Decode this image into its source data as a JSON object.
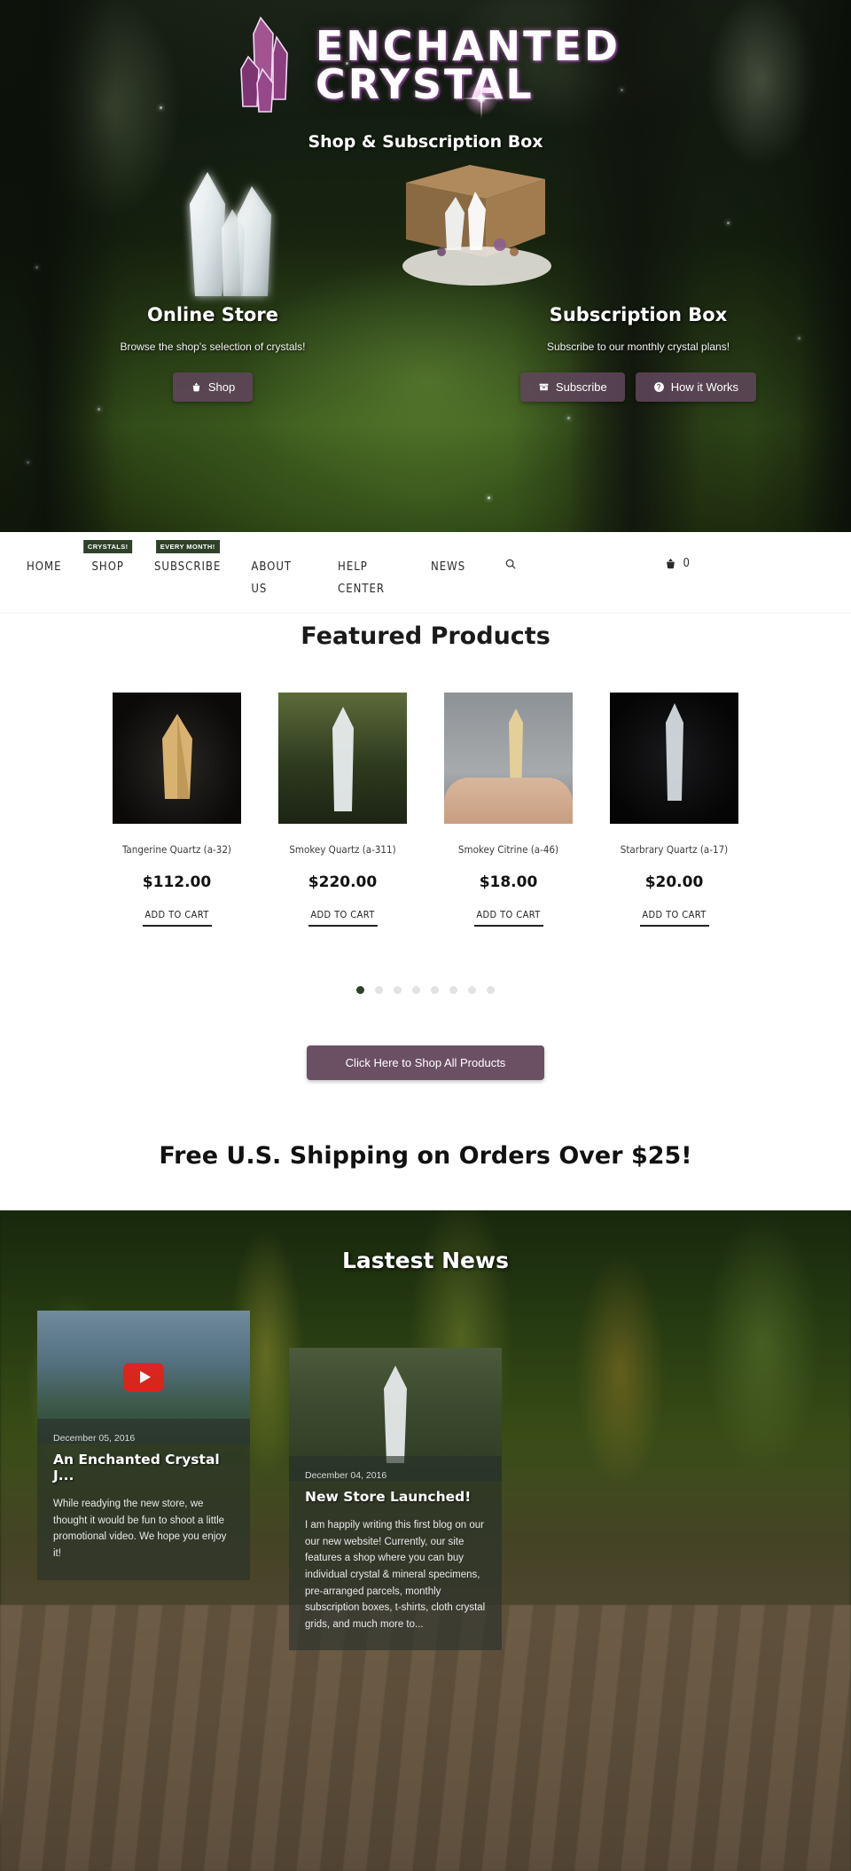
{
  "hero": {
    "logo_line1": "ENCHANTED",
    "logo_line2": "CRYSTAL",
    "tagline": "Shop & Subscription Box",
    "columns": [
      {
        "title": "Online Store",
        "subtitle": "Browse the shop's selection of crystals!",
        "buttons": [
          {
            "label": "Shop",
            "icon": "basket-icon"
          }
        ]
      },
      {
        "title": "Subscription Box",
        "subtitle": "Subscribe to our monthly crystal plans!",
        "buttons": [
          {
            "label": "Subscribe",
            "icon": "box-icon"
          },
          {
            "label": "How it Works",
            "icon": "question-circle-icon"
          }
        ]
      }
    ]
  },
  "nav": {
    "items": [
      {
        "label": "HOME",
        "badge": null
      },
      {
        "label": "SHOP",
        "badge": "CRYSTALS!"
      },
      {
        "label": "SUBSCRIBE",
        "badge": "EVERY MONTH!"
      },
      {
        "label": "ABOUT\nUS",
        "badge": null
      },
      {
        "label": "HELP\nCENTER",
        "badge": null
      },
      {
        "label": "NEWS",
        "badge": null
      }
    ],
    "search_icon": "search-icon",
    "cart_icon": "shopping-basket-icon",
    "cart_count": "0"
  },
  "featured": {
    "title": "Featured Products",
    "add_to_cart_label": "ADD TO CART",
    "products": [
      {
        "name": "Tangerine Quartz (a-32)",
        "price": "$112.00"
      },
      {
        "name": "Smokey Quartz (a-311)",
        "price": "$220.00"
      },
      {
        "name": "Smokey Citrine (a-46)",
        "price": "$18.00"
      },
      {
        "name": "Starbrary Quartz (a-17)",
        "price": "$20.00"
      }
    ],
    "carousel": {
      "total_dots": 8,
      "active_index": 0
    },
    "shop_all_label": "Click Here to Shop All Products"
  },
  "shipping_banner": "Free U.S. Shipping on Orders Over $25!",
  "news": {
    "title": "Lastest News",
    "posts": [
      {
        "date": "December 05, 2016",
        "headline": "An Enchanted Crystal J...",
        "excerpt": "While readying the new store, we thought it would be fun to shoot a little promotional video. We hope you enjoy it!",
        "has_video": true
      },
      {
        "date": "December 04, 2016",
        "headline": "New Store Launched!",
        "excerpt": "I am happily writing this first blog on our our new website! Currently, our site features a shop where you can buy individual crystal & mineral specimens, pre-arranged parcels, monthly subscription boxes, t-shirts, cloth crystal grids, and much more to...",
        "has_video": false
      }
    ]
  },
  "colors": {
    "accent_purple": "#6b5064",
    "badge_green": "#2d4229",
    "hero_button": "#5e465a",
    "text_dark": "#1a1a1a"
  }
}
